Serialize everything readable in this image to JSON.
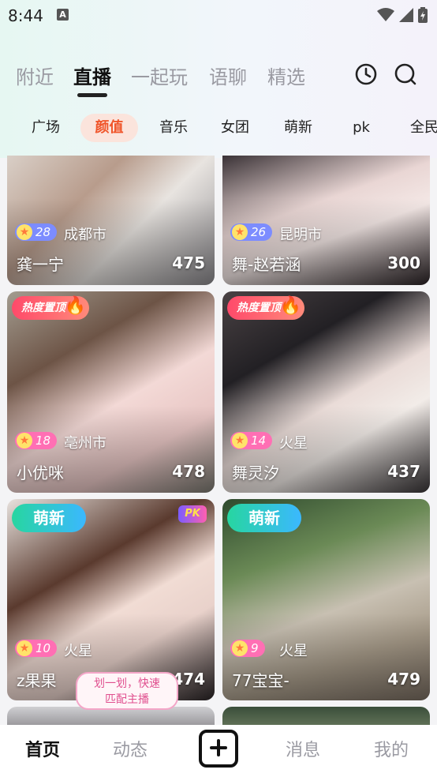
{
  "status_bar": {
    "time": "8:44",
    "notif_icon": "A"
  },
  "top_tabs": [
    "附近",
    "直播",
    "一起玩",
    "语聊",
    "精选"
  ],
  "active_tab": "直播",
  "categories": [
    "广场",
    "颜值",
    "音乐",
    "女团",
    "萌新",
    "pk",
    "全民"
  ],
  "active_category": "颜值",
  "cards": [
    {
      "level": "28",
      "city": "成都市",
      "name": "龚一宁",
      "viewers": "475"
    },
    {
      "level": "26",
      "city": "昆明市",
      "name": "舞-赵若涵",
      "viewers": "300"
    },
    {
      "badge": "热度置顶",
      "level": "18",
      "city": "亳州市",
      "name": "小优咪",
      "viewers": "478"
    },
    {
      "badge": "热度置顶",
      "level": "14",
      "city": "火星",
      "name": "舞灵汐",
      "viewers": "437"
    },
    {
      "badge": "萌新",
      "pk_label": "PK",
      "level": "10",
      "city": "火星",
      "name": "z果果",
      "viewers": "474"
    },
    {
      "badge": "萌新",
      "level": "9",
      "city": "火星",
      "name": "77宝宝-",
      "viewers": "479"
    }
  ],
  "tooltip": {
    "line1": "划一划，快速",
    "line2": "匹配主播"
  },
  "bottom_nav": {
    "home": "首页",
    "feed": "动态",
    "messages": "消息",
    "me": "我的"
  },
  "colors": {
    "accent": "#f0552a",
    "hot_badge": "#ff4a6a",
    "new_badge": "#27d6a0"
  }
}
